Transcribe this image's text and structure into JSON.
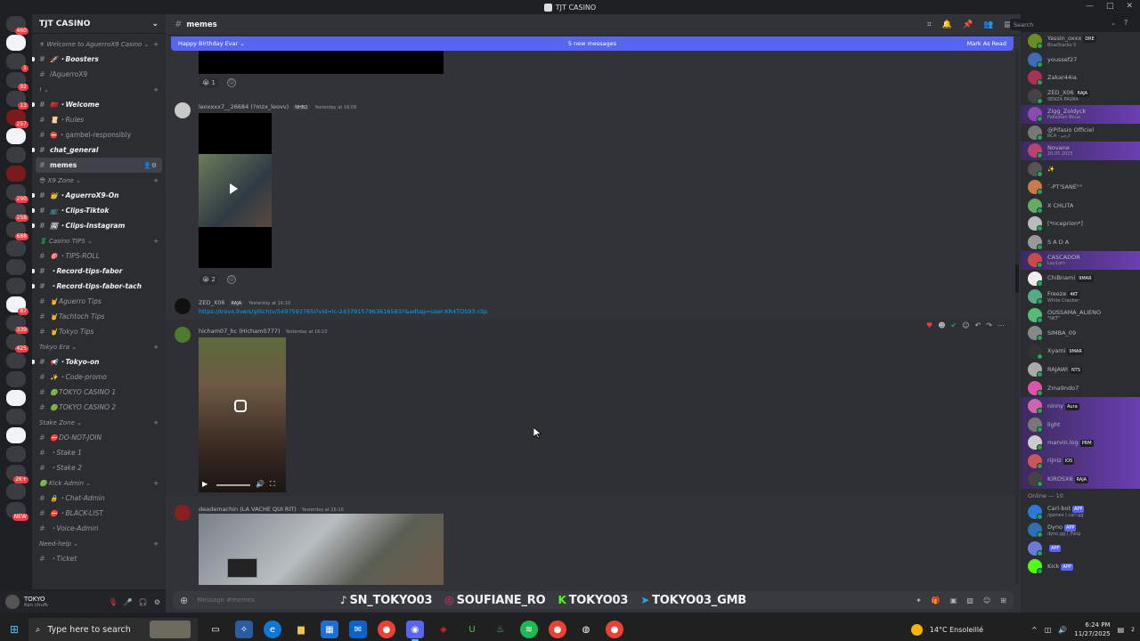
{
  "window": {
    "title": "TJT CASINO",
    "controls": [
      "—",
      "□",
      "✕"
    ]
  },
  "rail": {
    "servers": [
      {
        "name": "discord-home",
        "badge": "460",
        "color": "#3a3c42"
      },
      {
        "name": "stake",
        "badge": "",
        "color": "#f2f3f5"
      },
      {
        "name": "server-1",
        "badge": "1",
        "color": "#3a3c42"
      },
      {
        "name": "server-2",
        "badge": "92",
        "color": "#3a3c42"
      },
      {
        "name": "server-3",
        "badge": "13",
        "color": "#3a3c42"
      },
      {
        "name": "server-4",
        "badge": "257",
        "color": "#7a1a1a"
      },
      {
        "name": "server-5",
        "badge": "",
        "color": "#f2f3f5"
      },
      {
        "name": "server-6",
        "badge": "",
        "color": "#3a3c42"
      },
      {
        "name": "server-7",
        "badge": "",
        "color": "#7a1a1a"
      },
      {
        "name": "server-8",
        "badge": "290",
        "color": "#3a3c42"
      },
      {
        "name": "server-9",
        "badge": "258",
        "color": "#3a3c42"
      },
      {
        "name": "server-10",
        "badge": "688",
        "color": "#3a3c42"
      },
      {
        "name": "server-11",
        "badge": "",
        "color": "#3a3c42"
      },
      {
        "name": "server-12",
        "badge": "",
        "color": "#3a3c42"
      },
      {
        "name": "server-13",
        "badge": "",
        "color": "#3a3c42"
      },
      {
        "name": "server-14",
        "badge": "87",
        "color": "#f2f3f5"
      },
      {
        "name": "server-15",
        "badge": "339",
        "color": "#3a3c42"
      },
      {
        "name": "server-16",
        "badge": "425",
        "color": "#3a3c42"
      },
      {
        "name": "server-17",
        "badge": "",
        "color": "#3a3c42"
      },
      {
        "name": "server-18",
        "badge": "",
        "color": "#3a3c42"
      },
      {
        "name": "server-19",
        "badge": "",
        "color": "#f2f3f5"
      },
      {
        "name": "server-20",
        "badge": "",
        "color": "#3a3c42"
      },
      {
        "name": "server-21",
        "badge": "",
        "color": "#f2f3f5"
      },
      {
        "name": "server-22",
        "badge": "",
        "color": "#3a3c42"
      },
      {
        "name": "server-23",
        "badge": "2K+",
        "color": "#3a3c42"
      },
      {
        "name": "server-24",
        "badge": "",
        "color": "#3a3c42"
      },
      {
        "name": "server-new",
        "badge": "NEW",
        "color": "#3a3c42"
      }
    ]
  },
  "guild": {
    "name": "TJT CASINO"
  },
  "channels": [
    {
      "kind": "cat",
      "label": "⚜ Welcome to AguerroX9 Casino ⌄"
    },
    {
      "kind": "ch",
      "emoji": "🚀",
      "label": "・Boosters",
      "style": "unread"
    },
    {
      "kind": "ch",
      "emoji": "",
      "label": "/AguerroX9",
      "style": ""
    },
    {
      "kind": "cat",
      "label": "! ⌄"
    },
    {
      "kind": "ch",
      "emoji": "🇲🇦",
      "label": "・Welcome",
      "style": "unread"
    },
    {
      "kind": "ch",
      "emoji": "📜",
      "label": "・Rules",
      "style": "italic"
    },
    {
      "kind": "ch",
      "emoji": "⛔",
      "label": "・gambel-responsibly",
      "style": ""
    },
    {
      "kind": "ch",
      "emoji": "",
      "label": "chat_general",
      "style": "unread"
    },
    {
      "kind": "ch",
      "emoji": "",
      "label": "memes",
      "style": "active"
    },
    {
      "kind": "cat",
      "label": "😎 X9 Zone ⌄"
    },
    {
      "kind": "ch",
      "emoji": "👑",
      "label": "・AguerroX9-On",
      "style": "unread"
    },
    {
      "kind": "ch",
      "emoji": "📺",
      "label": "・Clips-Tiktok",
      "style": "unread"
    },
    {
      "kind": "ch",
      "emoji": "🖼",
      "label": "・Clips-Instagram",
      "style": "unread"
    },
    {
      "kind": "cat",
      "label": "💲 Casino TIPS ⌄"
    },
    {
      "kind": "ch",
      "emoji": "🎯",
      "label": "・TIPS-ROLL",
      "style": "italic"
    },
    {
      "kind": "ch",
      "emoji": "",
      "label": "・Record-tips-fabor",
      "style": "unread"
    },
    {
      "kind": "ch",
      "emoji": "",
      "label": "・Record-tips-fabor-tach",
      "style": "unread"
    },
    {
      "kind": "ch",
      "emoji": "🤘",
      "label": "Aguerro Tips",
      "style": "italic"
    },
    {
      "kind": "ch",
      "emoji": "🤘",
      "label": "Tachtoch Tips",
      "style": "italic"
    },
    {
      "kind": "ch",
      "emoji": "🤘",
      "label": "Tokyo Tips",
      "style": "italic"
    },
    {
      "kind": "cat",
      "label": "Tokyo Era ⌄"
    },
    {
      "kind": "ch",
      "emoji": "📢",
      "label": "・Tokyo-on",
      "style": "unread"
    },
    {
      "kind": "ch",
      "emoji": "✨",
      "label": "・Code-promo",
      "style": "italic"
    },
    {
      "kind": "ch",
      "emoji": "🟢",
      "label": "TOKYO CASINO 1",
      "style": "italic"
    },
    {
      "kind": "ch",
      "emoji": "🟢",
      "label": "TOKYO CASINO 2",
      "style": "italic"
    },
    {
      "kind": "cat",
      "label": "Stake Zone ⌄"
    },
    {
      "kind": "ch",
      "emoji": "⛔",
      "label": "DO-NOT-JOIN",
      "style": "italic"
    },
    {
      "kind": "ch",
      "emoji": "",
      "label": "・Stake 1",
      "style": "italic"
    },
    {
      "kind": "ch",
      "emoji": "",
      "label": "・Stake 2",
      "style": "italic"
    },
    {
      "kind": "cat",
      "label": "🟢 Kick Admin ⌄"
    },
    {
      "kind": "ch",
      "emoji": "🔒",
      "label": "・Chat-Admin",
      "style": "italic"
    },
    {
      "kind": "ch",
      "emoji": "⛔",
      "label": "・BLACK-LIST",
      "style": "italic"
    },
    {
      "kind": "ch",
      "emoji": "",
      "label": "・Voice-Admin",
      "style": "italic"
    },
    {
      "kind": "cat",
      "label": "Need-help ⌄"
    },
    {
      "kind": "ch",
      "emoji": "",
      "label": "・Ticket",
      "style": "italic"
    }
  ],
  "user": {
    "name": "TOKYO",
    "status": "Ken chufk"
  },
  "channel": {
    "name": "memes",
    "search_placeholder": "Search"
  },
  "banner": {
    "left": "Happy Birthday Evar ⌄",
    "center": "5 new messages",
    "right": "Mark As Read"
  },
  "messages": [
    {
      "author": "leoxxxx7__26684 (?mzx_leovv)",
      "tag": "NHB2",
      "time": "Yesterday at 16:09",
      "reaction": "😭 2"
    },
    {
      "author": "ZED_X06",
      "tag": "RAJA",
      "time": "Yesterday at 16:10",
      "link": "https://trovo.live/s/glitchtv/5497593785I?vid=lc-24379157963616583?&adtag=user.KR4TOS93.clip"
    },
    {
      "author": "hicham07_hc (Hicham0777)",
      "tag": "",
      "time": "Yesterday at 16:10"
    },
    {
      "author": "deademachin (LA VACHE QUI RIT)",
      "tag": "",
      "time": "Yesterday at 16:10"
    }
  ],
  "top_reaction": "😭 1",
  "composer": {
    "placeholder": "Message #memes"
  },
  "overlay_socials": [
    "SN_TOKYO03",
    "SOUFIANE_RO",
    "TOKYO03",
    "TOKYO03_GMB"
  ],
  "members": [
    {
      "name": "Yassin_oxxx",
      "sub": "BlueStacks 5",
      "badge": "DRE",
      "hl": false
    },
    {
      "name": "youssef27",
      "sub": "",
      "badge": "",
      "hl": false
    },
    {
      "name": "Zakar44ia",
      "sub": "",
      "badge": "",
      "hl": false
    },
    {
      "name": "ZED_X06",
      "sub": "SENZA PAURA",
      "badge": "RAJA",
      "hl": false
    },
    {
      "name": "Zigg_Zoldyck",
      "sub": "Pakastan Bnua",
      "badge": "",
      "hl": true
    },
    {
      "name": "@Pifasio Officiel",
      "sub": "RCA - ارحم",
      "badge": "",
      "hl": false
    },
    {
      "name": "Novane",
      "sub": "20.05.2025",
      "badge": "",
      "hl": true
    },
    {
      "name": "✨",
      "sub": "",
      "badge": "",
      "hl": false
    },
    {
      "name": "`-PT'SANÉ°°",
      "sub": "",
      "badge": "",
      "hl": false
    },
    {
      "name": "X CHLITA",
      "sub": "",
      "badge": "",
      "hl": false
    },
    {
      "name": "[*nceprion*]",
      "sub": "",
      "badge": "",
      "hl": false
    },
    {
      "name": "S A D A",
      "sub": "",
      "badge": "",
      "hl": false
    },
    {
      "name": "CASCADOR",
      "sub": "Lay1om",
      "badge": "",
      "hl": true
    },
    {
      "name": "ChiBnami",
      "sub": "",
      "badge": "9MAR",
      "hl": false
    },
    {
      "name": "Freeze",
      "sub": "White Cracker",
      "badge": "4KT",
      "hl": false
    },
    {
      "name": "OUSSAMA_ALIENO",
      "sub": "\"NKT\"",
      "badge": "",
      "hl": false
    },
    {
      "name": "SIMBA_09",
      "sub": "",
      "badge": "",
      "hl": false
    },
    {
      "name": "Xyami",
      "sub": "",
      "badge": "9MAR",
      "hl": false
    },
    {
      "name": "RAJAWI",
      "sub": "",
      "badge": "NTS",
      "hl": false
    },
    {
      "name": "Zma9ndo7",
      "sub": "",
      "badge": "",
      "hl": false
    },
    {
      "name": "ninny",
      "sub": "",
      "badge": "Aura",
      "hl": true
    },
    {
      "name": "light",
      "sub": "",
      "badge": "",
      "hl": true
    },
    {
      "name": "marvin.log",
      "sub": "",
      "badge": "PRM",
      "hl": true
    },
    {
      "name": "rijniz",
      "sub": "",
      "badge": "IOS",
      "hl": true
    },
    {
      "name": "KIROSX6",
      "sub": "",
      "badge": "RAJA",
      "hl": true
    }
  ],
  "online_group": "Online — 10",
  "online_members": [
    {
      "name": "Carl-bot",
      "sub": "/games | carl.gg",
      "badge": "APP"
    },
    {
      "name": "Dyno",
      "sub": "dyno.gg | /help",
      "badge": "APP"
    },
    {
      "name": "",
      "sub": "",
      "badge": "APP"
    },
    {
      "name": "Kick",
      "sub": "",
      "badge": "APP"
    }
  ],
  "taskbar": {
    "search_placeholder": "Type here to search",
    "weather": "14°C Ensoleillé",
    "time": "6:24 PM",
    "date": "11/27/2025",
    "notification_count": "2"
  }
}
